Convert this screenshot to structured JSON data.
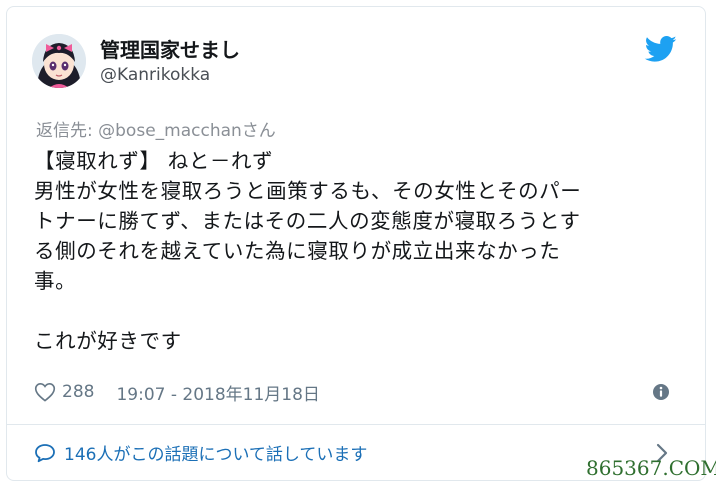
{
  "tweet": {
    "display_name": "管理国家せまし",
    "handle": "@Kanrikokka",
    "reply_prefix": "返信先: ",
    "reply_to": "@bose_macchan",
    "reply_suffix": "さん",
    "lines": [
      "【寝取れず】 ねと－れず",
      "男性が女性を寝取ろうと画策するも、その女性とそのパー",
      "トナーに勝てず、またはその二人の変態度が寝取ろうとす",
      "る側のそれを越えていた為に寝取りが成立出来なかった",
      "事。",
      "",
      "これが好きです"
    ],
    "likes": "288",
    "timestamp": "19:07 - 2018年11月18日",
    "conversation": "146人がこの話題について話しています"
  },
  "icons": {
    "brand": "twitter-bird-icon",
    "like": "heart-icon",
    "info": "info-icon",
    "conversation": "speech-bubble-icon",
    "chevron": "chevron-right-icon"
  },
  "colors": {
    "twitter_blue": "#1da1f2",
    "link_blue": "#1b6fb6",
    "meta_gray": "#657786"
  },
  "watermark": "865367.COM"
}
